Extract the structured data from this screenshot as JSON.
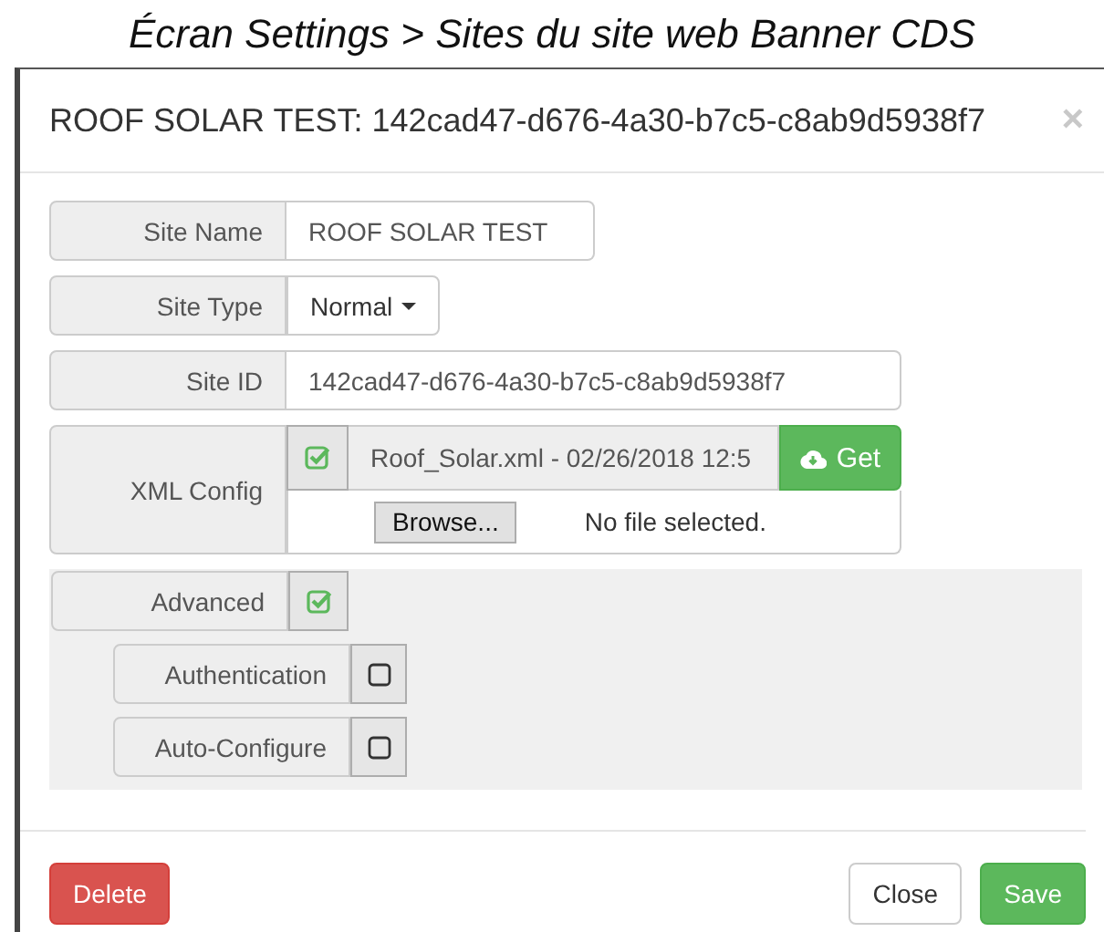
{
  "caption": "Écran Settings > Sites du site web Banner CDS",
  "dialog": {
    "title": "ROOF SOLAR TEST: 142cad47-d676-4a30-b7c5-c8ab9d5938f7",
    "close": "×"
  },
  "fields": [
    {
      "kind": "text",
      "label": "Site Name",
      "value": "ROOF SOLAR TEST"
    },
    {
      "kind": "dropdown",
      "label": "Site Type",
      "value": "Normal"
    },
    {
      "kind": "text",
      "label": "Site ID",
      "value": "142cad47-d676-4a30-b7c5-c8ab9d5938f7"
    },
    {
      "kind": "file",
      "label": "XML Config",
      "checked": true,
      "value": "Roof_Solar.xml - 02/26/2018 12:5",
      "get_button": "Get",
      "browse_button": "Browse...",
      "file_status": "No file selected."
    }
  ],
  "advanced": {
    "label": "Advanced",
    "checked": true,
    "options": [
      {
        "label": "Authentication",
        "checked": false
      },
      {
        "label": "Auto-Configure",
        "checked": false
      }
    ]
  },
  "footer_buttons": [
    {
      "kind": "danger",
      "label": "Delete"
    },
    {
      "kind": "default",
      "label": "Close"
    },
    {
      "kind": "success",
      "label": "Save"
    }
  ]
}
